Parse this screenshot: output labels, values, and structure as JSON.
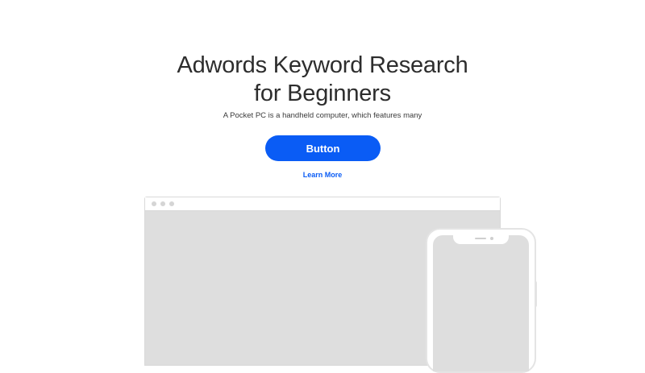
{
  "hero": {
    "title_line1": "Adwords Keyword Research",
    "title_line2": "for Beginners",
    "subtitle": "A Pocket PC is a handheld computer, which features many",
    "button_label": "Button",
    "learn_more_label": "Learn More"
  },
  "colors": {
    "accent": "#0a5cf5",
    "mockup_fill": "#dedede",
    "mockup_border": "#d9d9d9",
    "text": "#2d2d2d"
  },
  "mockups": {
    "desktop_icon": "browser-window-icon",
    "mobile_icon": "smartphone-icon"
  }
}
